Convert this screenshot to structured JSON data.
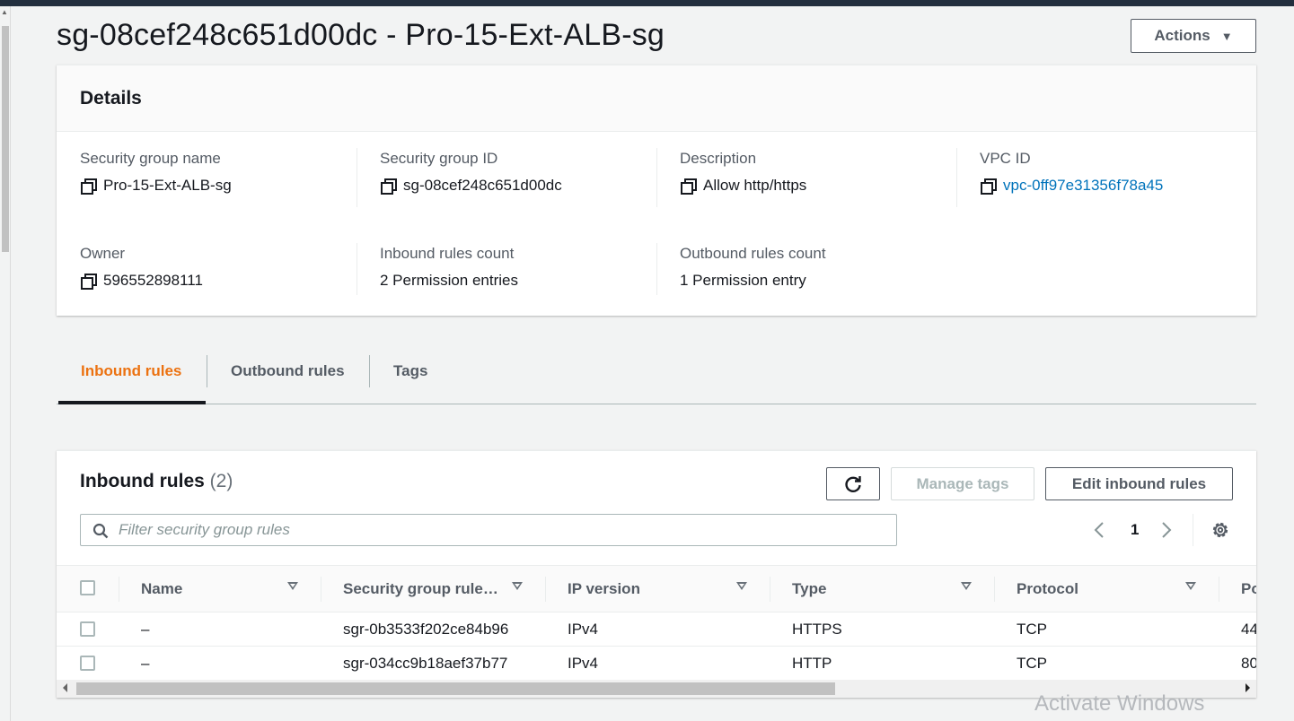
{
  "page": {
    "title": "sg-08cef248c651d00dc - Pro-15-Ext-ALB-sg",
    "actions_label": "Actions"
  },
  "details": {
    "header": "Details",
    "items": [
      {
        "label": "Security group name",
        "value": "Pro-15-Ext-ALB-sg"
      },
      {
        "label": "Security group ID",
        "value": "sg-08cef248c651d00dc"
      },
      {
        "label": "Description",
        "value": "Allow http/https"
      },
      {
        "label": "VPC ID",
        "value": "vpc-0ff97e31356f78a45"
      },
      {
        "label": "Owner",
        "value": "596552898111"
      },
      {
        "label": "Inbound rules count",
        "value": "2 Permission entries"
      },
      {
        "label": "Outbound rules count",
        "value": "1 Permission entry"
      }
    ]
  },
  "tabs": [
    {
      "label": "Inbound rules",
      "active": true
    },
    {
      "label": "Outbound rules",
      "active": false
    },
    {
      "label": "Tags",
      "active": false
    }
  ],
  "inbound": {
    "title": "Inbound rules",
    "count": "(2)",
    "manage_tags_label": "Manage tags",
    "edit_label": "Edit inbound rules",
    "search_placeholder": "Filter security group rules",
    "page": "1",
    "columns": [
      "Name",
      "Security group rule…",
      "IP version",
      "Type",
      "Protocol",
      "Po"
    ],
    "rows": [
      {
        "name": "–",
        "rule_id": "sgr-0b3533f202ce84b96",
        "ip_version": "IPv4",
        "type": "HTTPS",
        "protocol": "TCP",
        "port": "44"
      },
      {
        "name": "–",
        "rule_id": "sgr-034cc9b18aef37b77",
        "ip_version": "IPv4",
        "type": "HTTP",
        "protocol": "TCP",
        "port": "80"
      }
    ]
  },
  "watermark": "Activate Windows",
  "colors": {
    "accent": "#ec7211",
    "link": "#0073bb",
    "nav": "#232f3e"
  }
}
